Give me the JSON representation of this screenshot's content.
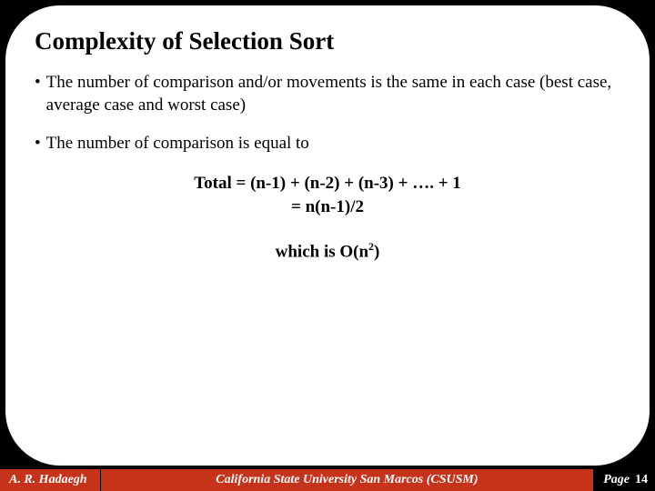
{
  "slide": {
    "title": "Complexity of Selection Sort",
    "bullets": [
      "The number of comparison and/or movements is the same in each case (best case, average case and worst case)",
      "The number of comparison is equal to"
    ],
    "formula": {
      "line1": "Total = (n-1) + (n-2) + (n-3) + …. + 1",
      "line2": "= n(n-1)/2"
    },
    "bigO_prefix": "which is O(n",
    "bigO_exp": "2",
    "bigO_suffix": ")"
  },
  "footer": {
    "author": "A. R. Hadaegh",
    "affiliation": "California State University San Marcos (CSUSM)",
    "page_label": "Page",
    "page_number": "14"
  }
}
